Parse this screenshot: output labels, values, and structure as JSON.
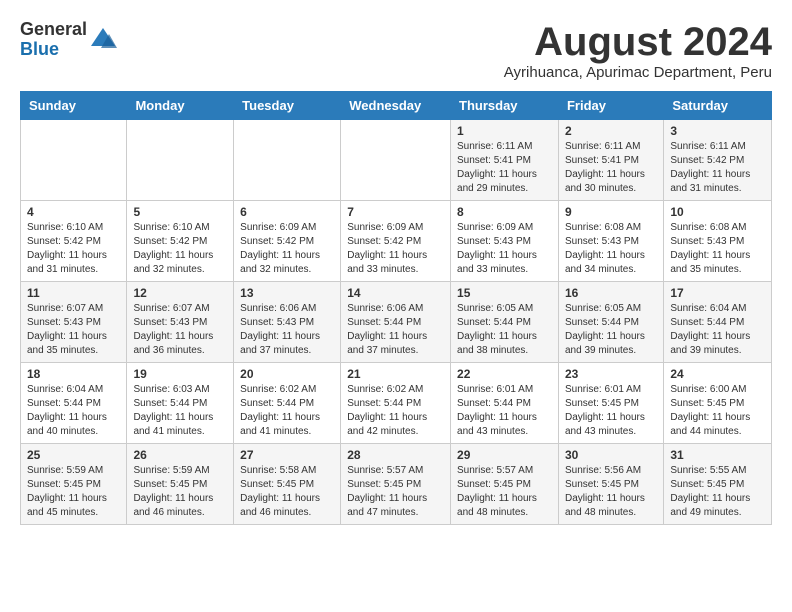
{
  "logo": {
    "general": "General",
    "blue": "Blue"
  },
  "title": "August 2024",
  "subtitle": "Ayrihuanca, Apurimac Department, Peru",
  "days_of_week": [
    "Sunday",
    "Monday",
    "Tuesday",
    "Wednesday",
    "Thursday",
    "Friday",
    "Saturday"
  ],
  "weeks": [
    [
      {
        "day": "",
        "content": ""
      },
      {
        "day": "",
        "content": ""
      },
      {
        "day": "",
        "content": ""
      },
      {
        "day": "",
        "content": ""
      },
      {
        "day": "1",
        "content": "Sunrise: 6:11 AM\nSunset: 5:41 PM\nDaylight: 11 hours and 29 minutes."
      },
      {
        "day": "2",
        "content": "Sunrise: 6:11 AM\nSunset: 5:41 PM\nDaylight: 11 hours and 30 minutes."
      },
      {
        "day": "3",
        "content": "Sunrise: 6:11 AM\nSunset: 5:42 PM\nDaylight: 11 hours and 31 minutes."
      }
    ],
    [
      {
        "day": "4",
        "content": "Sunrise: 6:10 AM\nSunset: 5:42 PM\nDaylight: 11 hours and 31 minutes."
      },
      {
        "day": "5",
        "content": "Sunrise: 6:10 AM\nSunset: 5:42 PM\nDaylight: 11 hours and 32 minutes."
      },
      {
        "day": "6",
        "content": "Sunrise: 6:09 AM\nSunset: 5:42 PM\nDaylight: 11 hours and 32 minutes."
      },
      {
        "day": "7",
        "content": "Sunrise: 6:09 AM\nSunset: 5:42 PM\nDaylight: 11 hours and 33 minutes."
      },
      {
        "day": "8",
        "content": "Sunrise: 6:09 AM\nSunset: 5:43 PM\nDaylight: 11 hours and 33 minutes."
      },
      {
        "day": "9",
        "content": "Sunrise: 6:08 AM\nSunset: 5:43 PM\nDaylight: 11 hours and 34 minutes."
      },
      {
        "day": "10",
        "content": "Sunrise: 6:08 AM\nSunset: 5:43 PM\nDaylight: 11 hours and 35 minutes."
      }
    ],
    [
      {
        "day": "11",
        "content": "Sunrise: 6:07 AM\nSunset: 5:43 PM\nDaylight: 11 hours and 35 minutes."
      },
      {
        "day": "12",
        "content": "Sunrise: 6:07 AM\nSunset: 5:43 PM\nDaylight: 11 hours and 36 minutes."
      },
      {
        "day": "13",
        "content": "Sunrise: 6:06 AM\nSunset: 5:43 PM\nDaylight: 11 hours and 37 minutes."
      },
      {
        "day": "14",
        "content": "Sunrise: 6:06 AM\nSunset: 5:44 PM\nDaylight: 11 hours and 37 minutes."
      },
      {
        "day": "15",
        "content": "Sunrise: 6:05 AM\nSunset: 5:44 PM\nDaylight: 11 hours and 38 minutes."
      },
      {
        "day": "16",
        "content": "Sunrise: 6:05 AM\nSunset: 5:44 PM\nDaylight: 11 hours and 39 minutes."
      },
      {
        "day": "17",
        "content": "Sunrise: 6:04 AM\nSunset: 5:44 PM\nDaylight: 11 hours and 39 minutes."
      }
    ],
    [
      {
        "day": "18",
        "content": "Sunrise: 6:04 AM\nSunset: 5:44 PM\nDaylight: 11 hours and 40 minutes."
      },
      {
        "day": "19",
        "content": "Sunrise: 6:03 AM\nSunset: 5:44 PM\nDaylight: 11 hours and 41 minutes."
      },
      {
        "day": "20",
        "content": "Sunrise: 6:02 AM\nSunset: 5:44 PM\nDaylight: 11 hours and 41 minutes."
      },
      {
        "day": "21",
        "content": "Sunrise: 6:02 AM\nSunset: 5:44 PM\nDaylight: 11 hours and 42 minutes."
      },
      {
        "day": "22",
        "content": "Sunrise: 6:01 AM\nSunset: 5:44 PM\nDaylight: 11 hours and 43 minutes."
      },
      {
        "day": "23",
        "content": "Sunrise: 6:01 AM\nSunset: 5:45 PM\nDaylight: 11 hours and 43 minutes."
      },
      {
        "day": "24",
        "content": "Sunrise: 6:00 AM\nSunset: 5:45 PM\nDaylight: 11 hours and 44 minutes."
      }
    ],
    [
      {
        "day": "25",
        "content": "Sunrise: 5:59 AM\nSunset: 5:45 PM\nDaylight: 11 hours and 45 minutes."
      },
      {
        "day": "26",
        "content": "Sunrise: 5:59 AM\nSunset: 5:45 PM\nDaylight: 11 hours and 46 minutes."
      },
      {
        "day": "27",
        "content": "Sunrise: 5:58 AM\nSunset: 5:45 PM\nDaylight: 11 hours and 46 minutes."
      },
      {
        "day": "28",
        "content": "Sunrise: 5:57 AM\nSunset: 5:45 PM\nDaylight: 11 hours and 47 minutes."
      },
      {
        "day": "29",
        "content": "Sunrise: 5:57 AM\nSunset: 5:45 PM\nDaylight: 11 hours and 48 minutes."
      },
      {
        "day": "30",
        "content": "Sunrise: 5:56 AM\nSunset: 5:45 PM\nDaylight: 11 hours and 48 minutes."
      },
      {
        "day": "31",
        "content": "Sunrise: 5:55 AM\nSunset: 5:45 PM\nDaylight: 11 hours and 49 minutes."
      }
    ]
  ]
}
